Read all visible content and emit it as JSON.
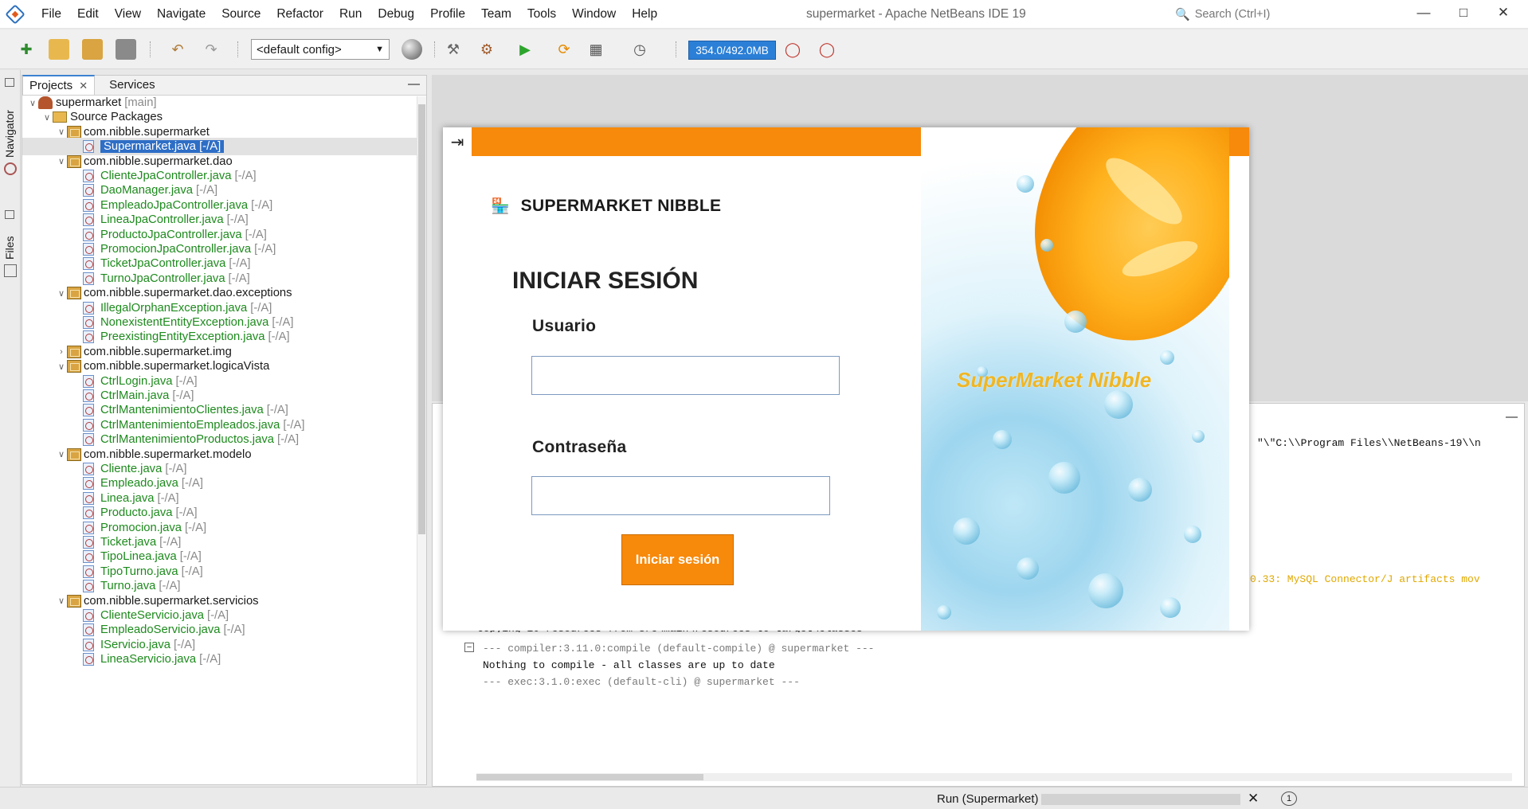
{
  "window": {
    "title": "supermarket - Apache NetBeans IDE 19",
    "search_placeholder": "Search (Ctrl+I)"
  },
  "menu": [
    "File",
    "Edit",
    "View",
    "Navigate",
    "Source",
    "Refactor",
    "Run",
    "Debug",
    "Profile",
    "Team",
    "Tools",
    "Window",
    "Help"
  ],
  "toolbar": {
    "config_value": "<default config>",
    "memory": "354.0/492.0MB"
  },
  "rail": {
    "navigator": "Navigator",
    "files": "Files"
  },
  "projects_panel": {
    "tabs": [
      "Projects",
      "Services"
    ],
    "tree": [
      {
        "label": "supermarket",
        "suffix": "[main]",
        "kind": "project"
      },
      {
        "label": "Source Packages",
        "suffix": "",
        "kind": "folder"
      },
      {
        "label": "com.nibble.supermarket",
        "suffix": "",
        "kind": "package"
      },
      {
        "label": "Supermarket.java [-/A]",
        "suffix": "",
        "kind": "file",
        "selected": true
      },
      {
        "label": "com.nibble.supermarket.dao",
        "suffix": "",
        "kind": "package"
      },
      {
        "label": "ClienteJpaController.java",
        "suffix": "[-/A]",
        "kind": "file"
      },
      {
        "label": "DaoManager.java",
        "suffix": "[-/A]",
        "kind": "file"
      },
      {
        "label": "EmpleadoJpaController.java",
        "suffix": "[-/A]",
        "kind": "file"
      },
      {
        "label": "LineaJpaController.java",
        "suffix": "[-/A]",
        "kind": "file"
      },
      {
        "label": "ProductoJpaController.java",
        "suffix": "[-/A]",
        "kind": "file"
      },
      {
        "label": "PromocionJpaController.java",
        "suffix": "[-/A]",
        "kind": "file"
      },
      {
        "label": "TicketJpaController.java",
        "suffix": "[-/A]",
        "kind": "file"
      },
      {
        "label": "TurnoJpaController.java",
        "suffix": "[-/A]",
        "kind": "file"
      },
      {
        "label": "com.nibble.supermarket.dao.exceptions",
        "suffix": "",
        "kind": "package"
      },
      {
        "label": "IllegalOrphanException.java",
        "suffix": "[-/A]",
        "kind": "file"
      },
      {
        "label": "NonexistentEntityException.java",
        "suffix": "[-/A]",
        "kind": "file"
      },
      {
        "label": "PreexistingEntityException.java",
        "suffix": "[-/A]",
        "kind": "file"
      },
      {
        "label": "com.nibble.supermarket.img",
        "suffix": "",
        "kind": "package-collapsed"
      },
      {
        "label": "com.nibble.supermarket.logicaVista",
        "suffix": "",
        "kind": "package"
      },
      {
        "label": "CtrlLogin.java",
        "suffix": "[-/A]",
        "kind": "file"
      },
      {
        "label": "CtrlMain.java",
        "suffix": "[-/A]",
        "kind": "file"
      },
      {
        "label": "CtrlMantenimientoClientes.java",
        "suffix": "[-/A]",
        "kind": "file"
      },
      {
        "label": "CtrlMantenimientoEmpleados.java",
        "suffix": "[-/A]",
        "kind": "file"
      },
      {
        "label": "CtrlMantenimientoProductos.java",
        "suffix": "[-/A]",
        "kind": "file"
      },
      {
        "label": "com.nibble.supermarket.modelo",
        "suffix": "",
        "kind": "package"
      },
      {
        "label": "Cliente.java",
        "suffix": "[-/A]",
        "kind": "file"
      },
      {
        "label": "Empleado.java",
        "suffix": "[-/A]",
        "kind": "file"
      },
      {
        "label": "Linea.java",
        "suffix": "[-/A]",
        "kind": "file"
      },
      {
        "label": "Producto.java",
        "suffix": "[-/A]",
        "kind": "file"
      },
      {
        "label": "Promocion.java",
        "suffix": "[-/A]",
        "kind": "file"
      },
      {
        "label": "Ticket.java",
        "suffix": "[-/A]",
        "kind": "file"
      },
      {
        "label": "TipoLinea.java",
        "suffix": "[-/A]",
        "kind": "file"
      },
      {
        "label": "TipoTurno.java",
        "suffix": "[-/A]",
        "kind": "file"
      },
      {
        "label": "Turno.java",
        "suffix": "[-/A]",
        "kind": "file"
      },
      {
        "label": "com.nibble.supermarket.servicios",
        "suffix": "",
        "kind": "package"
      },
      {
        "label": "ClienteServicio.java",
        "suffix": "[-/A]",
        "kind": "file"
      },
      {
        "label": "EmpleadoServicio.java",
        "suffix": "[-/A]",
        "kind": "file"
      },
      {
        "label": "IServicio.java",
        "suffix": "[-/A]",
        "kind": "file"
      },
      {
        "label": "LineaServicio.java",
        "suffix": "[-/A]",
        "kind": "file"
      }
    ]
  },
  "output": {
    "right_path": "\"\\\"C:\\\\Program Files\\\\NetBeans-19\\\\n",
    "warning": "0.33: MySQL Connector/J artifacts mov",
    "copying": "Copying 10 resources from src\\main\\resources to target\\classes",
    "compiler": "--- compiler:3.11.0:compile (default-compile) @ supermarket ---",
    "nothing": "Nothing to compile - all classes are up to date",
    "exec": "--- exec:3.1.0:exec (default-cli) @ supermarket ---"
  },
  "status": {
    "run_label": "Run (Supermarket)",
    "notifications": "1"
  },
  "login": {
    "brand": "SUPERMARKET NIBBLE",
    "title": "INICIAR SESIÓN",
    "user_label": "Usuario",
    "user_value": "",
    "password_label": "Contraseña",
    "password_value": "",
    "button": "Iniciar sesión",
    "hero_text": "SuperMarket Nibble",
    "accent_color": "#f7890b"
  }
}
